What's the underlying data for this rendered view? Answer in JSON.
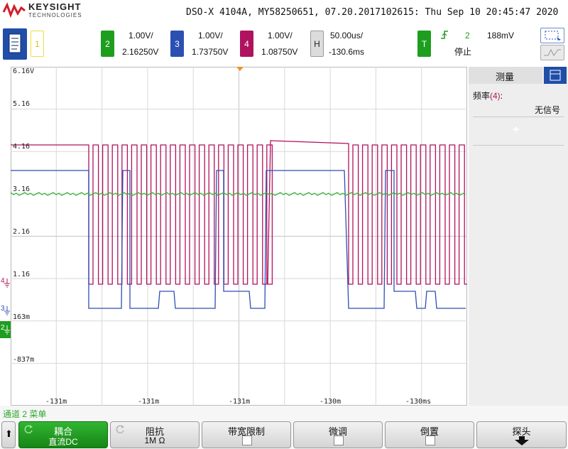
{
  "header": {
    "logo_line1": "KEYSIGHT",
    "logo_line2": "TECHNOLOGIES",
    "title": "DSO-X 4104A, MY58250651, 07.20.2017102615: Thu Sep 10 20:45:47 2020"
  },
  "channels": {
    "ch1": {
      "num": "1",
      "color": "#f5e23a"
    },
    "ch2": {
      "num": "2",
      "scale": "1.00V/",
      "offset": "2.16250V",
      "color": "#1e9e1e"
    },
    "ch3": {
      "num": "3",
      "scale": "1.00V/",
      "offset": "1.73750V",
      "color": "#2c4fb3"
    },
    "ch4": {
      "num": "4",
      "scale": "1.00V/",
      "offset": "1.08750V",
      "color": "#b0125f"
    }
  },
  "timebase": {
    "label": "H",
    "scale": "50.00us/",
    "delay": "-130.6ms"
  },
  "trigger": {
    "label": "T",
    "source": "2",
    "level": "188mV",
    "status": "停止"
  },
  "grid": {
    "y_labels": [
      "6.16V",
      "5.16",
      "4.16",
      "3.16",
      "2.16",
      "1.16",
      "163m",
      "-837m"
    ],
    "x_labels": [
      "-131m",
      "-131m",
      "-131m",
      "-130m",
      "-130ms"
    ]
  },
  "markers": {
    "ch4": "4",
    "ch3": "3",
    "ch2": "2"
  },
  "sidebar": {
    "tab_label": "测量",
    "measure_label": "频率",
    "measure_channel": "(4)",
    "measure_colon": ":",
    "measure_value": "无信号",
    "add_symbol": "+"
  },
  "softkeys": {
    "menu_title": "通道 2 菜单",
    "back_symbol": "⬆",
    "coupling": {
      "title": "耦合",
      "value": "直流DC"
    },
    "impedance": {
      "title": "阻抗",
      "value": "1M Ω"
    },
    "bw_limit": {
      "title": "带宽限制"
    },
    "fine": {
      "title": "微调"
    },
    "invert": {
      "title": "倒置"
    },
    "probe": {
      "title": "探头"
    }
  }
}
